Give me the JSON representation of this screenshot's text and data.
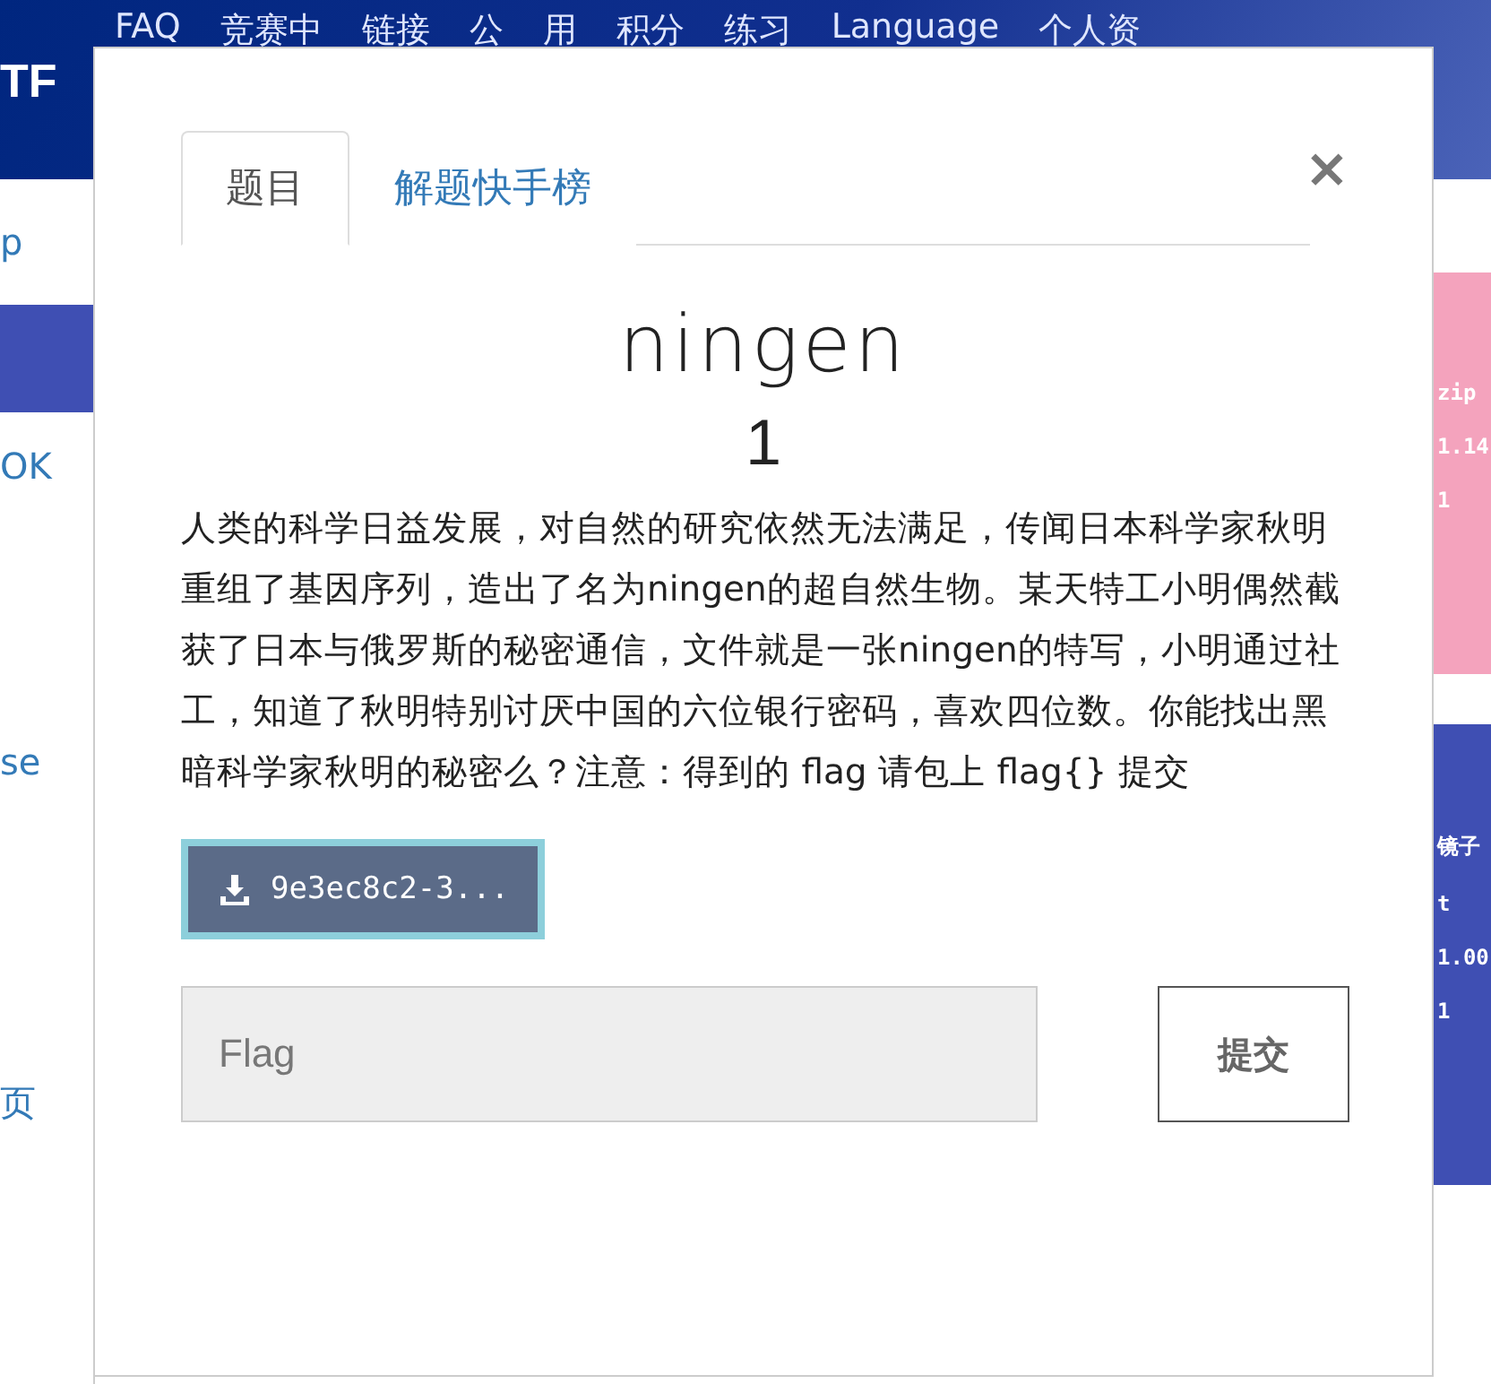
{
  "nav": {
    "logo": "TF",
    "items": [
      "FAQ",
      "竞赛中",
      "链接",
      "公",
      "用",
      "积分",
      "练习",
      "Language",
      "个人资"
    ]
  },
  "sidebar": {
    "items": [
      {
        "label": "p",
        "selected": false
      },
      {
        "selected": true
      },
      {
        "label": "OK",
        "selected": false
      },
      {
        "label": "se",
        "selected": false
      },
      {
        "label": "页",
        "selected": false
      }
    ]
  },
  "cards": [
    {
      "color": "#f4a3bd",
      "lines": [
        "zip",
        "1.14",
        "1"
      ]
    },
    {
      "color": "#3f4fb3",
      "lines": [
        "镜子",
        "t",
        "1.00",
        "1"
      ]
    }
  ],
  "modal": {
    "tabs": [
      {
        "label": "题目",
        "selected": true
      },
      {
        "label": "解题快手榜",
        "selected": false
      }
    ],
    "close": "×",
    "title": "ningen",
    "points": "1",
    "description": "人类的科学日益发展，对自然的研究依然无法满足，传闻日本科学家秋明重组了基因序列，造出了名为ningen的超自然生物。某天特工小明偶然截获了日本与俄罗斯的秘密通信，文件就是一张ningen的特写，小明通过社工，知道了秋明特别讨厌中国的六位银行密码，喜欢四位数。你能找出黑暗科学家秋明的秘密么？注意：得到的 flag 请包上 flag{} 提交",
    "download": "9e3ec8c2-3...",
    "flag": {
      "placeholder": "Flag"
    },
    "submit": "提交"
  }
}
